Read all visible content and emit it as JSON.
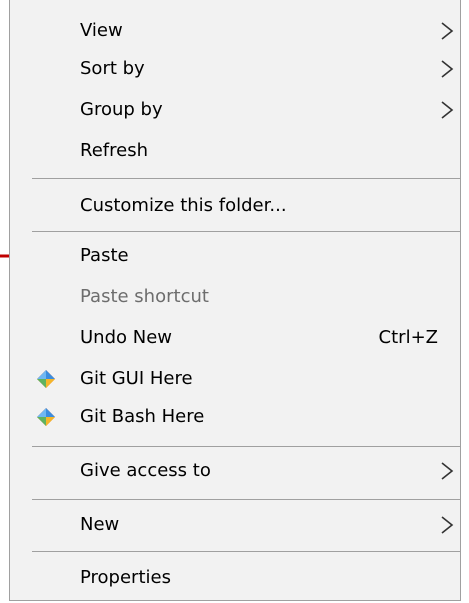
{
  "menu": {
    "items": [
      {
        "label": "View",
        "submenu": true,
        "icon": null
      },
      {
        "label": "Sort by",
        "submenu": true,
        "icon": null
      },
      {
        "label": "Group by",
        "submenu": true,
        "icon": null
      },
      {
        "label": "Refresh",
        "submenu": false,
        "icon": null
      },
      {
        "label": "Customize this folder...",
        "submenu": false,
        "icon": null
      },
      {
        "label": "Paste",
        "submenu": false,
        "icon": null
      },
      {
        "label": "Paste shortcut",
        "submenu": false,
        "disabled": true,
        "icon": null
      },
      {
        "label": "Undo New",
        "shortcut": "Ctrl+Z",
        "submenu": false,
        "icon": null
      },
      {
        "label": "Git GUI Here",
        "submenu": false,
        "icon": "git-diamond-icon"
      },
      {
        "label": "Git Bash Here",
        "submenu": false,
        "icon": "git-diamond-icon"
      },
      {
        "label": "Give access to",
        "submenu": true,
        "icon": null
      },
      {
        "label": "New",
        "submenu": true,
        "icon": null
      },
      {
        "label": "Properties",
        "submenu": false,
        "icon": null
      }
    ],
    "chevron_icon": "chevron-right-icon",
    "pointer_arrow_color": "#c00000",
    "background_color": "#f2f2f2",
    "separator_color": "#a0a0a0",
    "disabled_text_color": "#6d6d6d"
  }
}
